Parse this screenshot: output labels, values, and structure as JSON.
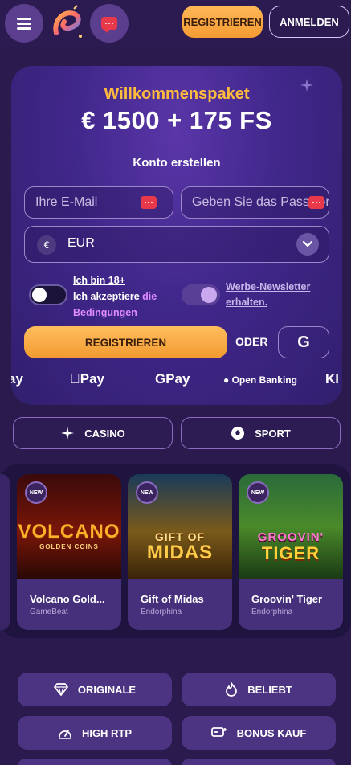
{
  "header": {
    "menu_icon": "hamburger-icon",
    "logo": "brand-logo",
    "chat_icon": "chat-icon",
    "register_label": "REGISTRIEREN",
    "login_label": "ANMELDEN",
    "accent": "#f7a73f"
  },
  "welcome": {
    "title": "Willkommenspaket",
    "bonus": "€ 1500 + 175 FS",
    "subtitle": "Konto erstellen",
    "email_placeholder": "Ihre E-Mail",
    "password_placeholder": "Geben Sie das Passwort ein",
    "currency_symbol": "€",
    "currency_value": "EUR",
    "age_line1": "Ich bin 18+",
    "age_line2_prefix": "Ich akzeptiere ",
    "age_line2_link": "die Bedingungen",
    "age_toggle_on": false,
    "newsletter_label": "Werbe-Newsletter erhalten.",
    "newsletter_toggle_on": true,
    "register_label": "REGISTRIEREN",
    "or_label": "ODER",
    "google_label": "G",
    "payments": [
      "ay",
      "Pay",
      "GPay",
      "Open Banking",
      "Kl"
    ]
  },
  "categories": {
    "casino": "CASINO",
    "sport": "SPORT"
  },
  "games": [
    {
      "name": "Volcano Gold...",
      "provider": "GameBeat",
      "badge": "NEW",
      "art_line1": "VOLCANO",
      "art_line2": "GOLDEN COINS"
    },
    {
      "name": "Gift of Midas",
      "provider": "Endorphina",
      "badge": "NEW",
      "art_line1": "GIFT OF",
      "art_line2": "MIDAS"
    },
    {
      "name": "Groovin' Tiger",
      "provider": "Endorphina",
      "badge": "NEW",
      "art_line1": "GROOVIN'",
      "art_line2": "TIGER"
    }
  ],
  "grid": [
    {
      "label": "ORIGINALE",
      "icon": "diamond-icon"
    },
    {
      "label": "BELIEBT",
      "icon": "flame-icon"
    },
    {
      "label": "HIGH RTP",
      "icon": "gauge-icon"
    },
    {
      "label": "BONUS KAUF",
      "icon": "cart-icon"
    }
  ]
}
